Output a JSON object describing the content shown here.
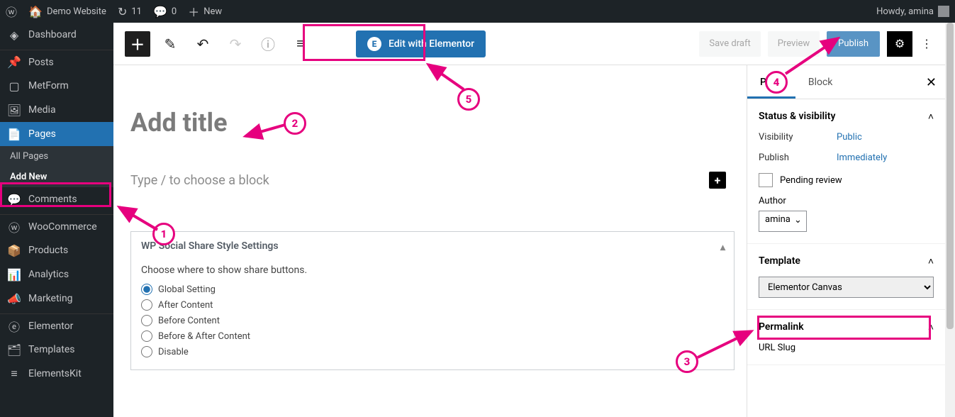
{
  "adminbar": {
    "site_name": "Demo Website",
    "update_count": "11",
    "comment_count": "0",
    "new_label": "New",
    "howdy": "Howdy, amina"
  },
  "adminmenu": {
    "dashboard": "Dashboard",
    "posts": "Posts",
    "metform": "MetForm",
    "media": "Media",
    "pages": "Pages",
    "pages_all": "All Pages",
    "pages_add": "Add New",
    "comments": "Comments",
    "woocommerce": "WooCommerce",
    "products": "Products",
    "analytics": "Analytics",
    "marketing": "Marketing",
    "elementor": "Elementor",
    "templates": "Templates",
    "elementskit": "ElementsKit"
  },
  "toolbar": {
    "elementor_label": "Edit with Elementor",
    "save_draft": "Save draft",
    "preview": "Preview",
    "publish": "Publish"
  },
  "editor": {
    "title_placeholder": "Add title",
    "body_placeholder": "Type / to choose a block"
  },
  "wpss": {
    "heading": "WP Social Share Style Settings",
    "prompt": "Choose where to show share buttons.",
    "options": [
      "Global Setting",
      "After Content",
      "Before Content",
      "Before & After Content",
      "Disable"
    ]
  },
  "sidebar": {
    "tab_page": "Page",
    "tab_block": "Block",
    "sec_status": "Status & visibility",
    "visibility_k": "Visibility",
    "visibility_v": "Public",
    "publish_k": "Publish",
    "publish_v": "Immediately",
    "pending": "Pending review",
    "author_label": "Author",
    "author_value": "amina",
    "sec_template": "Template",
    "template_value": "Elementor Canvas",
    "sec_permalink": "Permalink",
    "url_slug": "URL Slug"
  },
  "annotations": {
    "n1": "1",
    "n2": "2",
    "n3": "3",
    "n4": "4",
    "n5": "5"
  }
}
